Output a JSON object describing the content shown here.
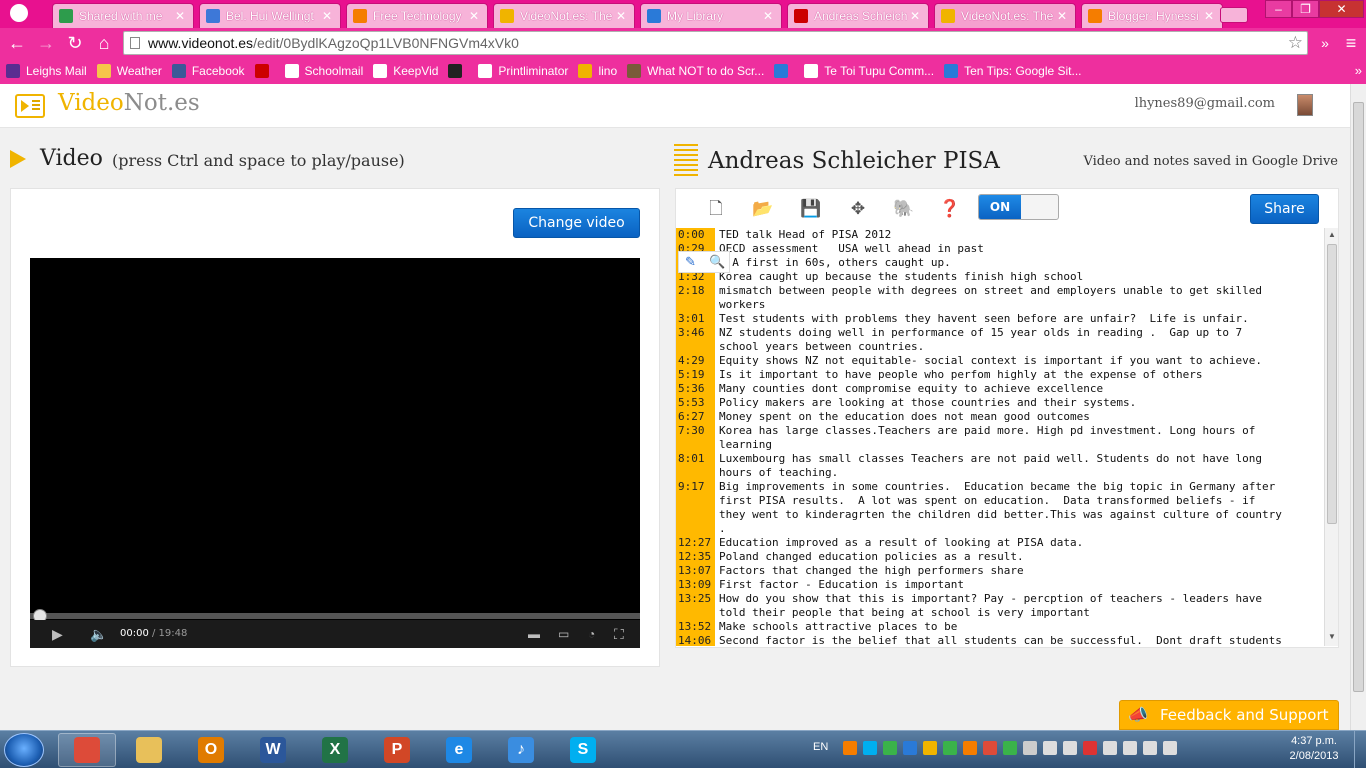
{
  "browser": {
    "tabs": [
      {
        "label": "Shared with me",
        "icon_color": "#2d9c4c"
      },
      {
        "label": "Bel. Hui Wellingt",
        "icon_color": "#3d78d8"
      },
      {
        "label": "Free Technology",
        "icon_color": "#f57d00"
      },
      {
        "label": "VideoNot.es: The",
        "icon_color": "#f0b400"
      },
      {
        "label": "My Library",
        "icon_color": "#2a7ad8"
      },
      {
        "label": "Andreas Schleich",
        "icon_color": "#cc0000"
      },
      {
        "label": "VideoNot.es: The",
        "icon_color": "#f0b400",
        "active": true
      },
      {
        "label": "Blogger: Hynessi",
        "icon_color": "#f57d00"
      }
    ],
    "close_glyph": "✕",
    "url_host": "www.videonot.es",
    "url_path": "/edit/0BydlKAgzoQp1LVB0NFNGVm4xVk0",
    "bookmarks": [
      {
        "label": "Leighs Mail",
        "icon_color": "#5a2d91"
      },
      {
        "label": "Weather",
        "icon_color": "#f6c64a"
      },
      {
        "label": "Facebook",
        "icon_color": "#3b5998"
      },
      {
        "label": "",
        "icon_color": "#cc0000"
      },
      {
        "label": "Schoolmail",
        "icon_color": "#ffffff"
      },
      {
        "label": "KeepVid",
        "icon_color": "#ffffff"
      },
      {
        "label": "",
        "icon_color": "#222222"
      },
      {
        "label": "Printliminator",
        "icon_color": "#ffffff"
      },
      {
        "label": "lino",
        "icon_color": "#f0b400"
      },
      {
        "label": "What NOT to do Scr...",
        "icon_color": "#7a5b3a"
      },
      {
        "label": "",
        "icon_color": "#2a7ad8"
      },
      {
        "label": "Te Toi Tupu Comm...",
        "icon_color": "#ffffff"
      },
      {
        "label": "Ten Tips: Google Sit...",
        "icon_color": "#2a7ad8"
      }
    ],
    "bookmarks_more": "»"
  },
  "app": {
    "logo_part1": "Video",
    "logo_part2": "Not.es",
    "user_email": "lhynes89@gmail.com",
    "video_heading": "Video",
    "video_hint": "(press Ctrl and space to play/pause)",
    "change_video_label": "Change video",
    "player": {
      "current_time": "00:00",
      "total_time": " / 19:48",
      "progress_fraction": 0.0
    },
    "doc_title": "Andreas Schleicher PISA",
    "saved_message": "Video and notes saved in Google Drive",
    "toggle_label": "ON",
    "share_label": "Share",
    "feedback_label": "Feedback and Support",
    "notes": [
      {
        "ts": "0:00",
        "text": "TED talk Head of PISA 2012"
      },
      {
        "ts": "0:29",
        "text": "OECD assessment   USA well ahead in past"
      },
      {
        "ts": "",
        "text": "  A first in 60s, others caught up."
      },
      {
        "ts": "1:32",
        "text": "Korea caught up because the students finish high school"
      },
      {
        "ts": "2:18",
        "text": "mismatch between people with degrees on street and employers unable to get skilled\nworkers"
      },
      {
        "ts": "3:01",
        "text": "Test students with problems they havent seen before are unfair?  Life is unfair."
      },
      {
        "ts": "3:46",
        "text": "NZ students doing well in performance of 15 year olds in reading .  Gap up to 7\nschool years between countries."
      },
      {
        "ts": "4:29",
        "text": "Equity shows NZ not equitable- social context is important if you want to achieve."
      },
      {
        "ts": "5:19",
        "text": "Is it important to have people who perfom highly at the expense of others"
      },
      {
        "ts": "5:36",
        "text": "Many counties dont compromise equity to achieve excellence"
      },
      {
        "ts": "5:53",
        "text": "Policy makers are looking at those countries and their systems."
      },
      {
        "ts": "6:27",
        "text": "Money spent on the education does not mean good outcomes"
      },
      {
        "ts": "7:30",
        "text": "Korea has large classes.Teachers are paid more. High pd investment. Long hours of\nlearning"
      },
      {
        "ts": "8:01",
        "text": "Luxembourg has small classes Teachers are not paid well. Students do not have long\nhours of teaching."
      },
      {
        "ts": "9:17",
        "text": "Big improvements in some countries.  Education became the big topic in Germany after\nfirst PISA results.  A lot was spent on education.  Data transformed beliefs - if\nthey went to kinderagrten the children did better.This was against culture of country\n."
      },
      {
        "ts": "12:27",
        "text": "Education improved as a result of looking at PISA data."
      },
      {
        "ts": "12:35",
        "text": "Poland changed education policies as a result."
      },
      {
        "ts": "13:07",
        "text": "Factors that changed the high performers share"
      },
      {
        "ts": "13:09",
        "text": "First factor - Education is important"
      },
      {
        "ts": "13:25",
        "text": "How do you show that this is important? Pay - percption of teachers - leaders have\ntold their people that being at school is very important"
      },
      {
        "ts": "13:52",
        "text": "Make schools attractive places to be"
      },
      {
        "ts": "14:06",
        "text": "Second factor is the belief that all students can be successful.  Dont draft students"
      }
    ]
  },
  "taskbar": {
    "language": "EN",
    "time": "4:37 p.m.",
    "date": "2/08/2013",
    "apps": [
      {
        "name": "chrome",
        "glyph": "",
        "color": "#dd4b39"
      },
      {
        "name": "explorer",
        "glyph": "",
        "color": "#e8c05a"
      },
      {
        "name": "outlook",
        "glyph": "O",
        "color": "#e07b00"
      },
      {
        "name": "word",
        "glyph": "W",
        "color": "#2b579a"
      },
      {
        "name": "excel",
        "glyph": "X",
        "color": "#217346"
      },
      {
        "name": "powerpoint",
        "glyph": "P",
        "color": "#d24726"
      },
      {
        "name": "internet-explorer",
        "glyph": "e",
        "color": "#1e88e5"
      },
      {
        "name": "itunes",
        "glyph": "♪",
        "color": "#3a8de0"
      },
      {
        "name": "skype",
        "glyph": "S",
        "color": "#00aff0"
      }
    ],
    "tray_colors": [
      "#f57d00",
      "#00aff0",
      "#3ab34a",
      "#2a7ad8",
      "#f0b400",
      "#3ab34a",
      "#f57d00",
      "#dd4b39",
      "#3ab34a",
      "#cccccc",
      "#dddddd",
      "#dddddd",
      "#dd3333",
      "#dddddd",
      "#dddddd",
      "#dddddd",
      "#dddddd"
    ]
  }
}
